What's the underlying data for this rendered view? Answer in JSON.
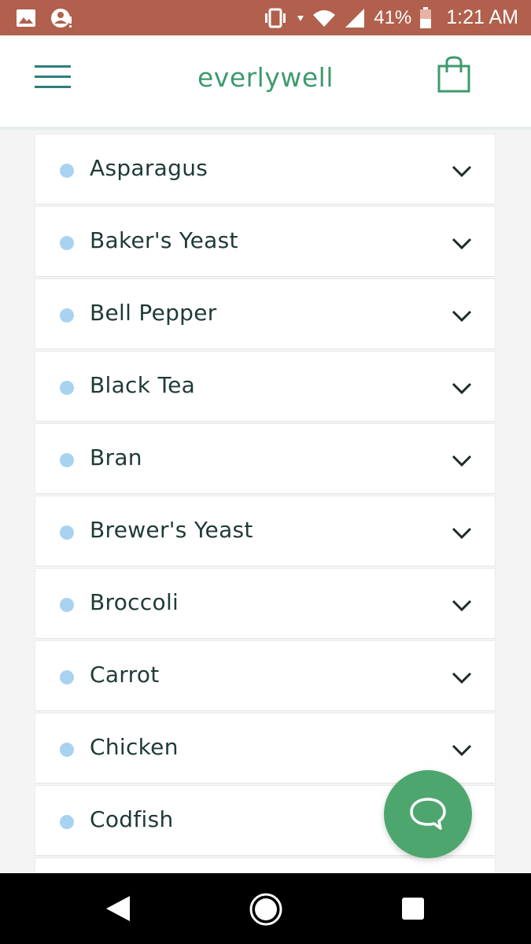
{
  "status_bar": {
    "battery_percent": "41%",
    "time": "1:21 AM",
    "icons": [
      "image-icon",
      "account-alert-icon",
      "vibrate-icon",
      "wifi-icon",
      "cell-signal-icon",
      "battery-icon"
    ]
  },
  "header": {
    "logo": "everlywell",
    "menu_icon": "hamburger-menu-icon",
    "cart_icon": "shopping-bag-icon"
  },
  "colors": {
    "status_bar": "#b0604c",
    "brand_green": "#3d9b6e",
    "dot": "#a7d3f0",
    "chat_button": "#4ea66f",
    "text": "#1f3a36"
  },
  "list": {
    "items": [
      {
        "label": "Asparagus"
      },
      {
        "label": "Baker's Yeast"
      },
      {
        "label": "Bell Pepper"
      },
      {
        "label": "Black Tea"
      },
      {
        "label": "Bran"
      },
      {
        "label": "Brewer's Yeast"
      },
      {
        "label": "Broccoli"
      },
      {
        "label": "Carrot"
      },
      {
        "label": "Chicken"
      },
      {
        "label": "Codfish"
      }
    ]
  },
  "chat": {
    "icon": "chat-bubble-icon"
  },
  "nav": {
    "back_icon": "back-triangle-icon",
    "home_icon": "home-circle-icon",
    "recent_icon": "recent-apps-square-icon"
  }
}
